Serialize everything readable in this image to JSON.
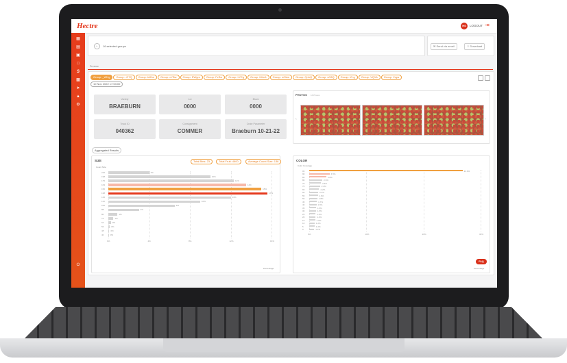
{
  "app": {
    "logo": "Hectre",
    "avatar_initials": "HS",
    "logout_label": "LOGOUT"
  },
  "sidebar": {
    "icons": [
      "grid-icon",
      "chart-icon",
      "truck-icon",
      "document-icon",
      "s-logo-icon",
      "scan-icon",
      "send-icon",
      "building-icon",
      "gear-icon"
    ]
  },
  "header": {
    "selected_groups": "16 selected groups",
    "send_email_label": "Send via email",
    "download_label": "Download"
  },
  "tabs": {
    "active": "Preview"
  },
  "groups": {
    "chips": [
      "Group: _WHg",
      "Group: -G7Q",
      "Group: bMhn",
      "Group: cYBw",
      "Group: EWgm",
      "Group: FvSw",
      "Group: LYEg",
      "Group: M4vA",
      "Group: mSdw",
      "Group: QnhQ",
      "Group: sC8Q",
      "Group: tG-g",
      "Group: VQ1A",
      "Group: Xrgw"
    ],
    "date": "10 Nov 2022 17:53:00"
  },
  "info": [
    {
      "label": "Variety",
      "value": "BRAEBURN"
    },
    {
      "label": "Lot",
      "value": "0000"
    },
    {
      "label": "Block",
      "value": "0000"
    },
    {
      "label": "Truck ID",
      "value": "040362"
    },
    {
      "label": "Consignment",
      "value": "COMMER"
    },
    {
      "label": "Crate Parameter",
      "value": "Braeburn 10-21-22"
    }
  ],
  "photos": {
    "title": "PHOTOS",
    "count": "16 Photos"
  },
  "aggregated_label": "Aggregated Results",
  "size": {
    "title": "SIZE",
    "total_bins": "Total Bins: 23",
    "total_fruit": "Total Fruit: 4600",
    "avg_count": "Average Count Size: 138",
    "ylabel": "Count Size",
    "xlabel": "Percentage",
    "x_ticks": [
      "0%",
      "4%",
      "8%",
      "12%",
      "16%"
    ],
    "rows": [
      {
        "label": "216",
        "value": 4.0,
        "value_label": "7%",
        "highlight": 0
      },
      {
        "label": "198",
        "value": 10.0,
        "value_label": "10%",
        "highlight": 0
      },
      {
        "label": "175",
        "value": 12.3,
        "value_label": "12%",
        "highlight": 0
      },
      {
        "label": "163",
        "value": 13.5,
        "value_label": "14%",
        "highlight": 1
      },
      {
        "label": "150",
        "value": 15.0,
        "value_label": "15%",
        "highlight": 2
      },
      {
        "label": "138",
        "value": 15.6,
        "value_label": "17%",
        "highlight": 3
      },
      {
        "label": "125",
        "value": 12.0,
        "value_label": "13%",
        "highlight": 0
      },
      {
        "label": "113",
        "value": 9.0,
        "value_label": "10%",
        "highlight": 0
      },
      {
        "label": "100",
        "value": 6.5,
        "value_label": "6%",
        "highlight": 0
      },
      {
        "label": "88",
        "value": 3.0,
        "value_label": "3%",
        "highlight": 0
      },
      {
        "label": "80",
        "value": 0.9,
        "value_label": "1%",
        "highlight": 0
      },
      {
        "label": "72",
        "value": 0.5,
        "value_label": "1%",
        "highlight": 0
      },
      {
        "label": "64",
        "value": 0.25,
        "value_label": "0%",
        "highlight": 0
      },
      {
        "label": "56",
        "value": 0.15,
        "value_label": "0%",
        "highlight": 0
      },
      {
        "label": "48",
        "value": 0.1,
        "value_label": "0%",
        "highlight": 0
      },
      {
        "label": "40",
        "value": 0.05,
        "value_label": "0%",
        "highlight": 0
      }
    ]
  },
  "color": {
    "title": "COLOR",
    "ylabel": "Color Coverage",
    "xlabel": "Percentage",
    "x_ticks": [
      "0%",
      "10%",
      "20%",
      "30%"
    ],
    "fab_label": "FAQ",
    "rows": [
      {
        "label": "95",
        "value": 34,
        "highlight": 2
      },
      {
        "label": "90",
        "value": 4.5,
        "highlight": 1
      },
      {
        "label": "85",
        "value": 3.8,
        "highlight": 1
      },
      {
        "label": "80",
        "value": 2.9,
        "highlight": 0
      },
      {
        "label": "75",
        "value": 2.6,
        "highlight": 0
      },
      {
        "label": "70",
        "value": 2.4,
        "highlight": 0
      },
      {
        "label": "65",
        "value": 2.2,
        "highlight": 0
      },
      {
        "label": "60",
        "value": 2.0,
        "highlight": 0
      },
      {
        "label": "55",
        "value": 1.9,
        "highlight": 0
      },
      {
        "label": "50",
        "value": 1.8,
        "highlight": 0
      },
      {
        "label": "45",
        "value": 1.7,
        "highlight": 0
      },
      {
        "label": "40",
        "value": 1.6,
        "highlight": 0
      },
      {
        "label": "35",
        "value": 1.5,
        "highlight": 0
      },
      {
        "label": "30",
        "value": 1.5,
        "highlight": 0
      },
      {
        "label": "25",
        "value": 1.4,
        "highlight": 0
      },
      {
        "label": "20",
        "value": 1.4,
        "highlight": 0
      },
      {
        "label": "15",
        "value": 1.3,
        "highlight": 0
      },
      {
        "label": "10",
        "value": 1.2,
        "highlight": 0
      },
      {
        "label": "5",
        "value": 1.2,
        "highlight": 0
      },
      {
        "label": "0",
        "value": 1.1,
        "highlight": 0
      }
    ]
  },
  "colors": {
    "brand": "#e4361b",
    "accent": "#f0a040",
    "bar_gray": "#d4d4d4",
    "bar_light": "#f7b8a8",
    "bar_mid": "#f08a72",
    "bar_strong": "#e5381c"
  }
}
